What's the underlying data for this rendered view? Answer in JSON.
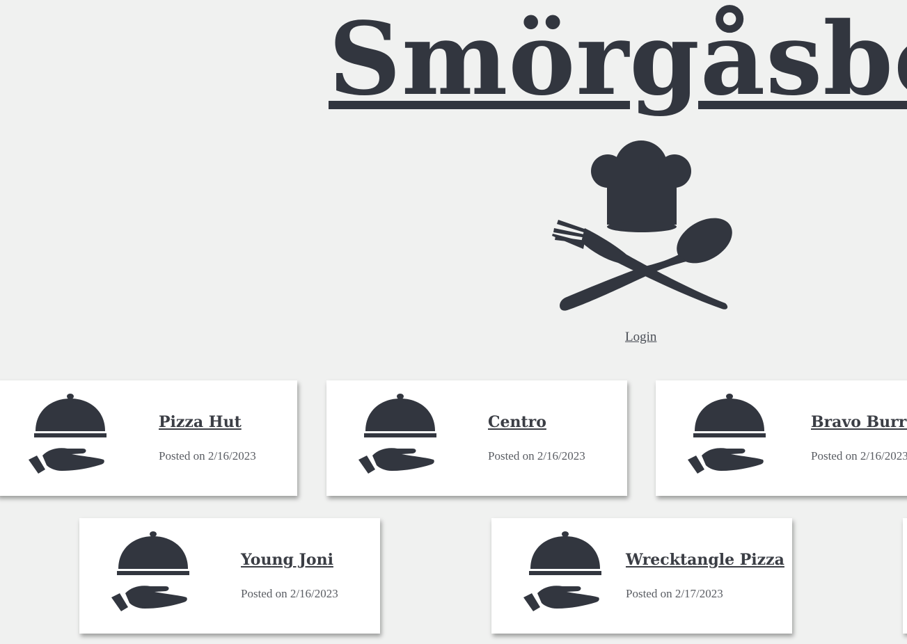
{
  "header": {
    "title": "Smörgåsbord",
    "logo_icon": "chef-hat-fork-spoon-icon",
    "login_label": "Login"
  },
  "colors": {
    "background": "#f0f1f0",
    "text_dark": "#32363f",
    "card_background": "#ffffff"
  },
  "restaurants": [
    {
      "name": "Pizza Hut",
      "posted": "Posted on 2/16/2023",
      "icon": "serving-cloche-hand-icon"
    },
    {
      "name": "Centro",
      "posted": "Posted on 2/16/2023",
      "icon": "serving-cloche-hand-icon"
    },
    {
      "name": "Bravo Burrito",
      "posted": "Posted on 2/16/2023",
      "icon": "serving-cloche-hand-icon"
    },
    {
      "name": "Young Joni",
      "posted": "Posted on 2/16/2023",
      "icon": "serving-cloche-hand-icon"
    },
    {
      "name": "Wrecktangle Pizza",
      "posted": "Posted on 2/17/2023",
      "icon": "serving-cloche-hand-icon"
    }
  ]
}
